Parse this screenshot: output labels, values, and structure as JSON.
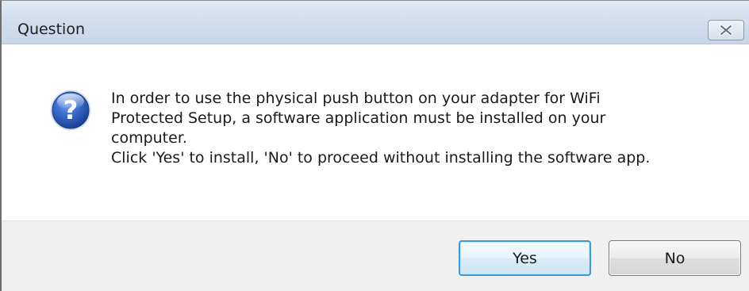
{
  "window": {
    "title": "Question",
    "close_icon": "close-x-icon"
  },
  "message": {
    "icon": "question-mark-icon",
    "lines": [
      "In order to use the physical push button on your adapter for WiFi",
      "Protected Setup, a software application must be installed on your",
      "computer.",
      "Click 'Yes' to install, 'No' to proceed without installing the software app."
    ]
  },
  "buttons": {
    "yes_label": "Yes",
    "no_label": "No"
  },
  "colors": {
    "titlebar": "#cfdded",
    "footer": "#f0f0f0",
    "icon_blue": "#2a57b5",
    "default_button_border": "#3c9bd8"
  }
}
